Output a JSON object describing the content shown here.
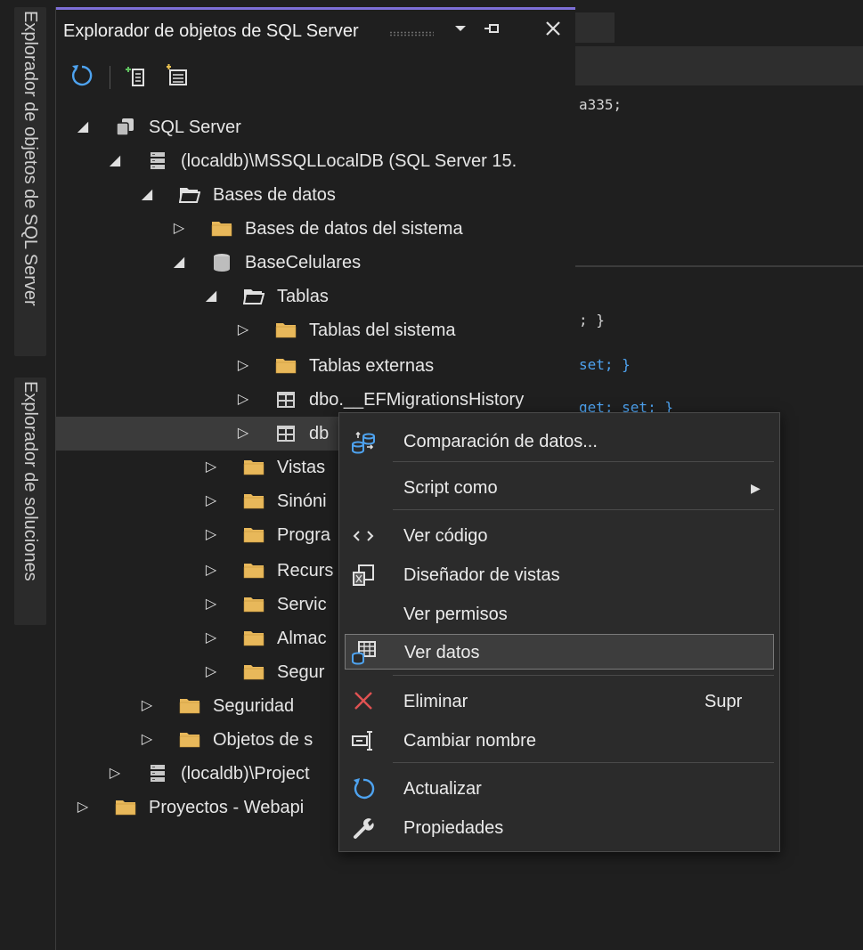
{
  "side_tabs": {
    "object_explorer": "Explorador de objetos de SQL Server",
    "solution_explorer": "Explorador de soluciones"
  },
  "panel": {
    "title": "Explorador de objetos de SQL Server",
    "dropdown_icon": "chevron-down-icon",
    "pin_icon": "pin-icon",
    "close_icon": "close-icon",
    "toolbar": [
      "refresh-icon",
      "add-server-icon",
      "filter-icon"
    ]
  },
  "tree": [
    {
      "label": "SQL Server",
      "icon": "server-group-icon",
      "state": "expanded"
    },
    {
      "label": "(localdb)\\MSSQLLocalDB (SQL Server 15.",
      "icon": "server-icon",
      "state": "expanded"
    },
    {
      "label": "Bases de datos",
      "icon": "folder-open-icon",
      "state": "expanded"
    },
    {
      "label": "Bases de datos del sistema",
      "icon": "folder-icon",
      "state": "collapsed"
    },
    {
      "label": "BaseCelulares",
      "icon": "database-icon",
      "state": "expanded"
    },
    {
      "label": "Tablas",
      "icon": "folder-open-icon",
      "state": "expanded"
    },
    {
      "label": "Tablas del sistema",
      "icon": "folder-icon",
      "state": "collapsed"
    },
    {
      "label": "Tablas externas",
      "icon": "folder-icon",
      "state": "collapsed"
    },
    {
      "label": "dbo.__EFMigrationsHistory",
      "icon": "table-icon",
      "state": "collapsed"
    },
    {
      "label": "db",
      "icon": "table-icon",
      "state": "collapsed",
      "selected": true
    },
    {
      "label": "Vistas",
      "icon": "folder-icon",
      "state": "collapsed"
    },
    {
      "label": "Sinóni",
      "icon": "folder-icon",
      "state": "collapsed"
    },
    {
      "label": "Progra",
      "icon": "folder-icon",
      "state": "collapsed"
    },
    {
      "label": "Recurs",
      "icon": "folder-icon",
      "state": "collapsed"
    },
    {
      "label": "Servic",
      "icon": "folder-icon",
      "state": "collapsed"
    },
    {
      "label": "Almac",
      "icon": "folder-icon",
      "state": "collapsed"
    },
    {
      "label": "Segur",
      "icon": "folder-icon",
      "state": "collapsed"
    },
    {
      "label": "Seguridad",
      "icon": "folder-icon",
      "state": "collapsed"
    },
    {
      "label": "Objetos de s",
      "icon": "folder-icon",
      "state": "collapsed"
    },
    {
      "label": "(localdb)\\Project",
      "icon": "server-icon",
      "state": "collapsed"
    },
    {
      "label": "Proyectos - Webapi",
      "icon": "folder-icon",
      "state": "collapsed"
    }
  ],
  "editor": {
    "lines": [
      "a335;",
      "; }",
      "set; }",
      "get; set; }"
    ]
  },
  "context_menu": {
    "items": [
      {
        "label": "Comparación de datos...",
        "icon": "data-compare-icon"
      },
      {
        "label": "Script como",
        "icon": "",
        "submenu": true
      },
      {
        "label": "Ver código",
        "icon": "code-icon"
      },
      {
        "label": "Diseñador de vistas",
        "icon": "designer-icon"
      },
      {
        "label": "Ver permisos",
        "icon": ""
      },
      {
        "label": "Ver datos",
        "icon": "view-data-icon",
        "highlighted": true
      },
      {
        "label": "Eliminar",
        "icon": "delete-icon",
        "shortcut": "Supr"
      },
      {
        "label": "Cambiar nombre",
        "icon": "rename-icon"
      },
      {
        "label": "Actualizar",
        "icon": "refresh-icon"
      },
      {
        "label": "Propiedades",
        "icon": "wrench-icon"
      }
    ]
  },
  "colors": {
    "background": "#1f1f1f",
    "accent": "#7d6fd8",
    "folder": "#e8b85a",
    "delete": "#e05252",
    "highlight": "#3d3d3d"
  }
}
